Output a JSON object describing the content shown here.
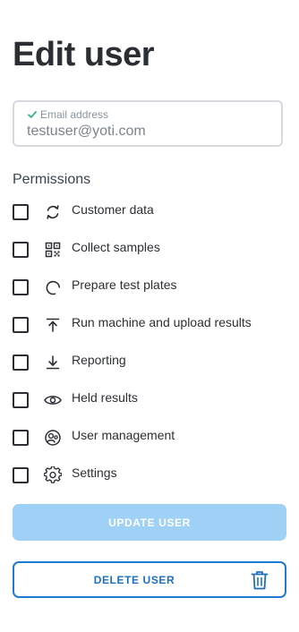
{
  "page": {
    "title": "Edit user"
  },
  "email": {
    "label": "Email address",
    "value": "testuser@yoti.com",
    "valid": true
  },
  "permissions": {
    "heading": "Permissions",
    "items": [
      {
        "label": "Customer data",
        "icon": "refresh-icon",
        "checked": false
      },
      {
        "label": "Collect samples",
        "icon": "qr-code-icon",
        "checked": false
      },
      {
        "label": "Prepare test plates",
        "icon": "spinner-icon",
        "checked": false
      },
      {
        "label": "Run machine and upload results",
        "icon": "upload-icon",
        "checked": false
      },
      {
        "label": "Reporting",
        "icon": "download-icon",
        "checked": false
      },
      {
        "label": "Held results",
        "icon": "eye-icon",
        "checked": false
      },
      {
        "label": "User management",
        "icon": "user-circle-icon",
        "checked": false
      },
      {
        "label": "Settings",
        "icon": "gear-icon",
        "checked": false
      }
    ]
  },
  "actions": {
    "update_label": "UPDATE USER",
    "update_disabled": true,
    "delete_label": "DELETE USER"
  },
  "colors": {
    "primary": "#1e7ad3",
    "primary_disabled": "#9fd1f7",
    "valid_check": "#35b38a",
    "text": "#2b2f33"
  }
}
